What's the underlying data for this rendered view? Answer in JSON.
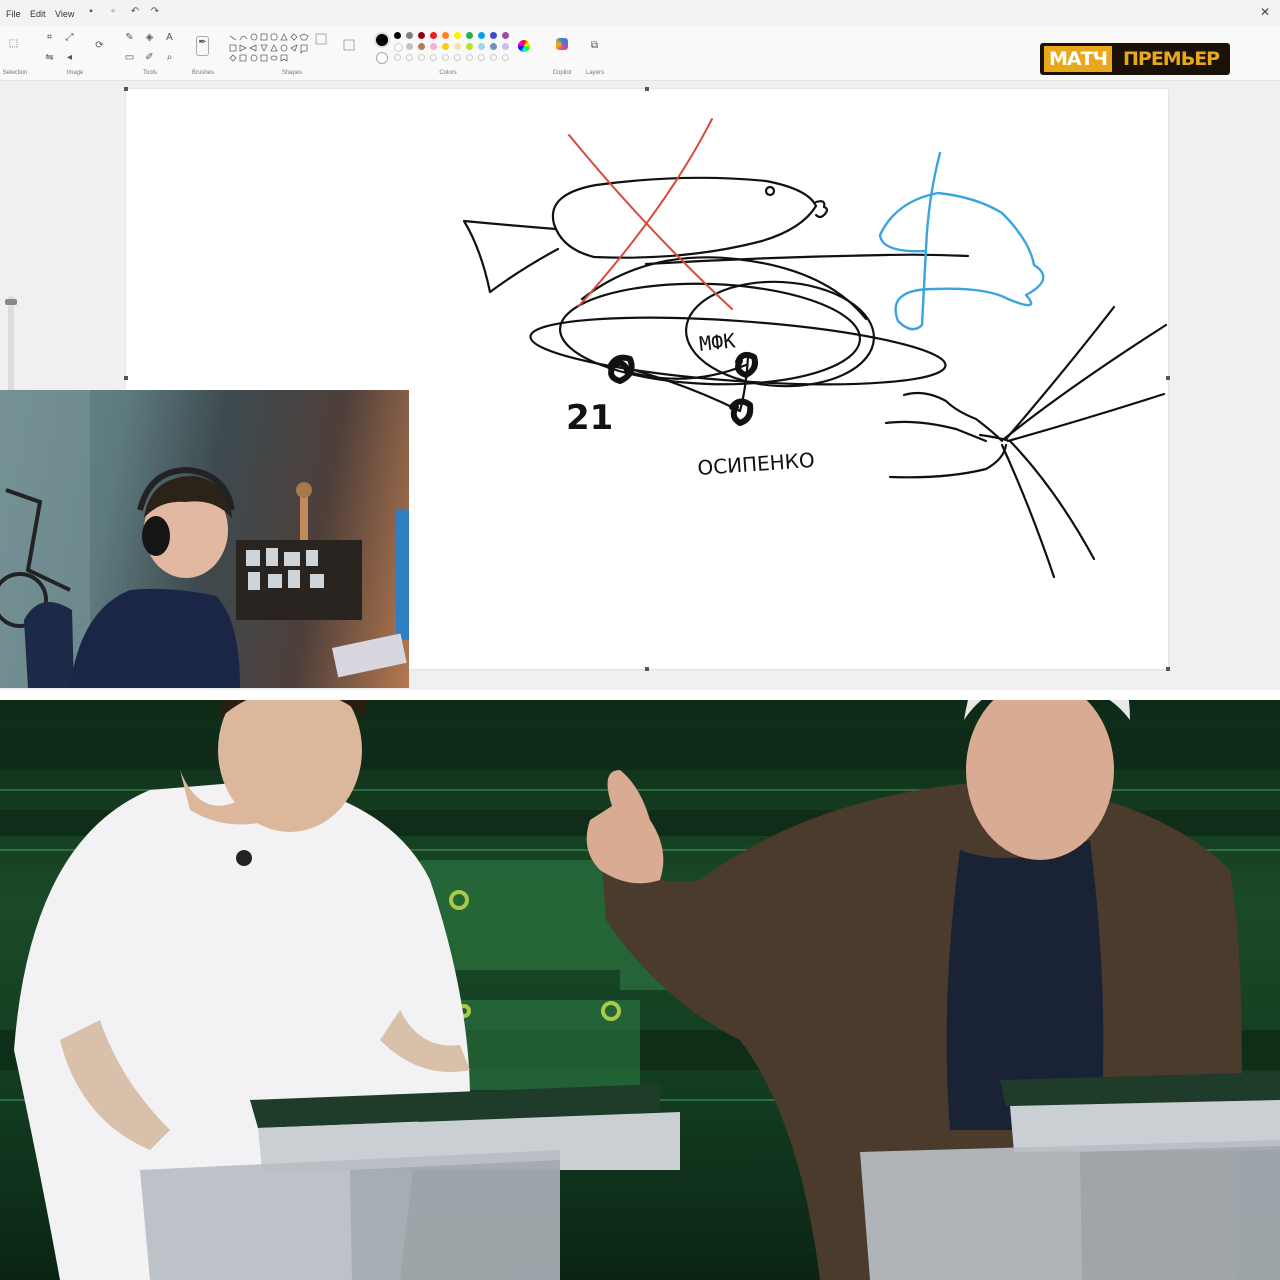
{
  "menu": {
    "file": "File",
    "edit": "Edit",
    "view": "View"
  },
  "ribbon": {
    "groups": {
      "selection": "Selection",
      "image": "Image",
      "tools": "Tools",
      "brushes": "Brushes",
      "shapes": "Shapes",
      "colors": "Colors",
      "copilot": "Copilot",
      "layers": "Layers"
    },
    "palette": [
      "#000000",
      "#7f7f7f",
      "#880015",
      "#ed1c24",
      "#ff7f27",
      "#fff200",
      "#22b14c",
      "#00a2e8",
      "#3f48cc",
      "#a349a4",
      "#ffffff",
      "#c3c3c3",
      "#b97a57",
      "#ffaec9",
      "#ffc90e",
      "#efe4b0",
      "#b5e61d",
      "#99d9ea",
      "#7092be",
      "#c8bfe7"
    ]
  },
  "logo": {
    "part1": "МАТЧ",
    "part2": "ПРЕМЬЕР",
    "accent": "#e8a81a"
  },
  "canvas": {
    "labels": {
      "center": "МФК",
      "left": "21",
      "bottom": "ОСИПЕНКО"
    },
    "stroke_colors": {
      "ink": "#111111",
      "red": "#d9493a",
      "blue": "#3aa4e0"
    }
  },
  "studio": {
    "accent": "#1f6b34"
  }
}
